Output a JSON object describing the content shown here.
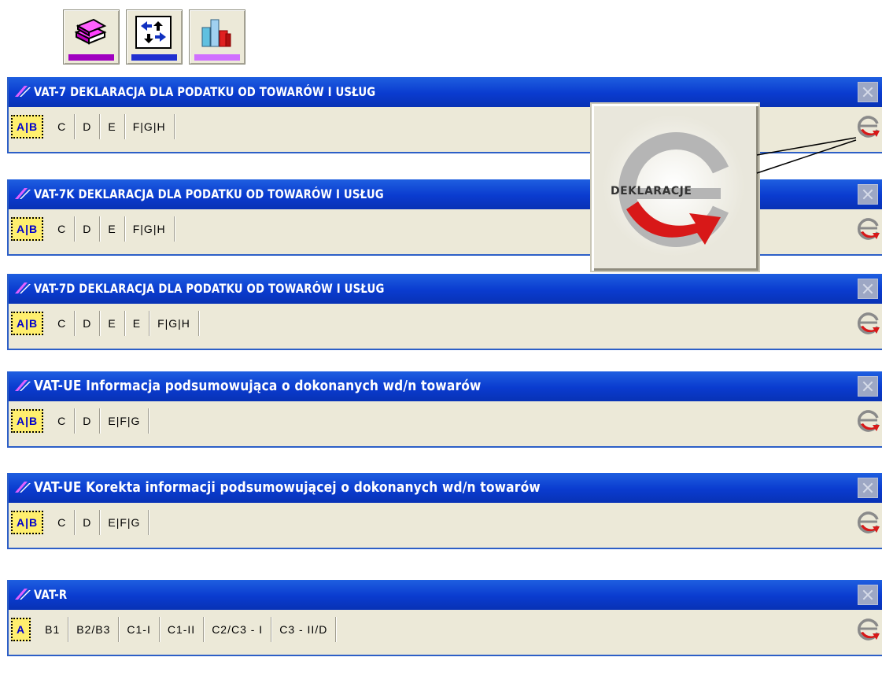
{
  "toolbar": {
    "buttons": [
      {
        "icon": "books-icon",
        "stripe": "#a000c0"
      },
      {
        "icon": "arrows-exchange-icon",
        "stripe": "#2030d0"
      },
      {
        "icon": "bar-chart-icon",
        "stripe": "#d070ff"
      }
    ]
  },
  "panels": [
    {
      "title": "VAT-7 DEKLARACJA DLA PODATKU OD TOWARÓW I USŁUG",
      "tabs": [
        "A|B",
        "C",
        "D",
        "E",
        "F|G|H"
      ]
    },
    {
      "title": "VAT-7K DEKLARACJA DLA PODATKU OD TOWARÓW I USŁUG",
      "tabs": [
        "A|B",
        "C",
        "D",
        "E",
        "F|G|H"
      ]
    },
    {
      "title": "VAT-7D DEKLARACJA DLA PODATKU OD TOWARÓW I USŁUG",
      "tabs": [
        "A|B",
        "C",
        "D",
        "E",
        "E",
        "F|G|H"
      ]
    },
    {
      "title": "VAT-UE Informacja podsumowująca o dokonanych wd/n towarów",
      "tabs": [
        "A|B",
        "C",
        "D",
        "E|F|G"
      ]
    },
    {
      "title": "VAT-UE Korekta informacji podsumowującej o dokonanych wd/n towarów",
      "tabs": [
        "A|B",
        "C",
        "D",
        "E|F|G"
      ]
    },
    {
      "title": "VAT-R",
      "tabs": [
        "A",
        "B1",
        "B2/B3",
        "C1-I",
        "C1-II",
        "C2/C3 - I",
        "C3 - II/D"
      ]
    }
  ],
  "logo": {
    "label": "DEKLARACJE"
  },
  "colors": {
    "titlebar": "#0a3bcf",
    "panel_bg": "#ece9d8",
    "active_tab_bg": "#ffef6e",
    "active_tab_text": "#0000cc"
  }
}
